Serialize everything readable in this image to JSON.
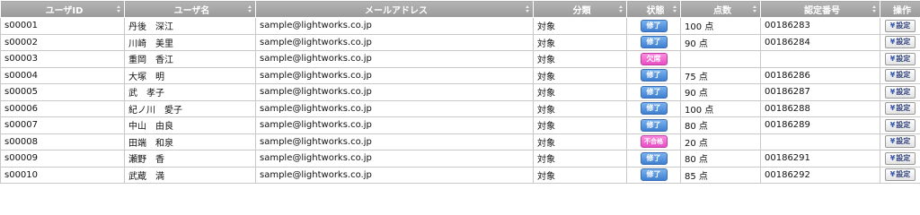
{
  "columns": [
    "ユーザID",
    "ユーザ名",
    "メールアドレス",
    "分類",
    "状態",
    "点数",
    "認定番号",
    "操作"
  ],
  "rows": [
    {
      "id": "s00001",
      "name": "丹後　深江",
      "email": "sample@lightworks.co.jp",
      "category": "対象",
      "status": "修了",
      "status_type": "done",
      "score": "100 点",
      "cert": "00186283",
      "op": "設定"
    },
    {
      "id": "s00002",
      "name": "川崎　美里",
      "email": "sample@lightworks.co.jp",
      "category": "対象",
      "status": "修了",
      "status_type": "done",
      "score": "90 点",
      "cert": "00186284",
      "op": "設定"
    },
    {
      "id": "s00003",
      "name": "重岡　香江",
      "email": "sample@lightworks.co.jp",
      "category": "対象",
      "status": "欠席",
      "status_type": "absent",
      "score": "",
      "cert": "",
      "op": "設定"
    },
    {
      "id": "s00004",
      "name": "大塚　明",
      "email": "sample@lightworks.co.jp",
      "category": "対象",
      "status": "修了",
      "status_type": "done",
      "score": "75 点",
      "cert": "00186286",
      "op": "設定"
    },
    {
      "id": "s00005",
      "name": "武　孝子",
      "email": "sample@lightworks.co.jp",
      "category": "対象",
      "status": "修了",
      "status_type": "done",
      "score": "90 点",
      "cert": "00186287",
      "op": "設定"
    },
    {
      "id": "s00006",
      "name": "紀ノ川　愛子",
      "email": "sample@lightworks.co.jp",
      "category": "対象",
      "status": "修了",
      "status_type": "done",
      "score": "100 点",
      "cert": "00186288",
      "op": "設定"
    },
    {
      "id": "s00007",
      "name": "中山　由良",
      "email": "sample@lightworks.co.jp",
      "category": "対象",
      "status": "修了",
      "status_type": "done",
      "score": "80 点",
      "cert": "00186289",
      "op": "設定"
    },
    {
      "id": "s00008",
      "name": "田端　和泉",
      "email": "sample@lightworks.co.jp",
      "category": "対象",
      "status": "不合格",
      "status_type": "fail",
      "score": "20 点",
      "cert": "",
      "op": "設定"
    },
    {
      "id": "s00009",
      "name": "瀬野　香",
      "email": "sample@lightworks.co.jp",
      "category": "対象",
      "status": "修了",
      "status_type": "done",
      "score": "80 点",
      "cert": "00186291",
      "op": "設定"
    },
    {
      "id": "s00010",
      "name": "武蔵　満",
      "email": "sample@lightworks.co.jp",
      "category": "対象",
      "status": "修了",
      "status_type": "done",
      "score": "85 点",
      "cert": "00186292",
      "op": "設定"
    }
  ],
  "colors": {
    "header_bg": "#a8a8a8",
    "done_badge": "#4f8ddb",
    "absent_badge": "#f06ad2",
    "fail_badge": "#f06ad2"
  },
  "icons": {
    "sort": "sort-icon",
    "settings": "wrench-icon"
  }
}
